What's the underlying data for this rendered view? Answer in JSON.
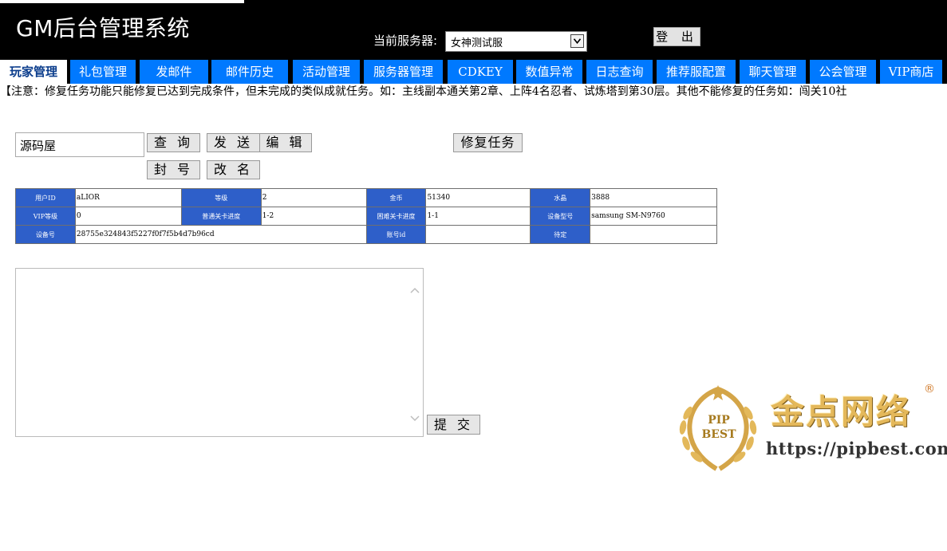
{
  "header": {
    "title": "GM后台管理系统",
    "server_label": "当前服务器:",
    "server_value": "女神测试服",
    "logout_label": "登 出"
  },
  "nav": {
    "tabs": [
      {
        "label": "玩家管理",
        "active": true
      },
      {
        "label": "礼包管理"
      },
      {
        "label": "发邮件"
      },
      {
        "label": "邮件历史"
      },
      {
        "label": "活动管理"
      },
      {
        "label": "服务器管理"
      },
      {
        "label": "CDKEY"
      },
      {
        "label": "数值异常"
      },
      {
        "label": "日志查询"
      },
      {
        "label": "推荐服配置"
      },
      {
        "label": "聊天管理"
      },
      {
        "label": "公会管理"
      },
      {
        "label": "VIP商店"
      }
    ]
  },
  "notice": "【注意：修复任务功能只能修复已达到完成条件，但未完成的类似成就任务。如：主线副本通关第2章、上阵4名忍者、试炼塔到第30层。其他不能修复的任务如：闯关10社",
  "search": {
    "input_value": "源码屋",
    "query_label": "查 询",
    "send_label": "发 送",
    "edit_label": "编 辑",
    "repair_label": "修复任务",
    "ban_label": "封 号",
    "rename_label": "改 名"
  },
  "player_info": {
    "row1": [
      {
        "label": "用户ID",
        "value": "aLIOR"
      },
      {
        "label": "等级",
        "value": "2"
      },
      {
        "label": "金币",
        "value": "51340"
      },
      {
        "label": "水晶",
        "value": "3888"
      }
    ],
    "row2": [
      {
        "label": "VIP等级",
        "value": "0"
      },
      {
        "label": "普通关卡进度",
        "value": "1-2"
      },
      {
        "label": "困难关卡进度",
        "value": "1-1"
      },
      {
        "label": "设备型号",
        "value": "samsung SM-N9760"
      }
    ],
    "row3": [
      {
        "label": "设备号",
        "value": "28755e324843f5227f0f7f5b4d7b96cd"
      },
      {
        "label": "账号id",
        "value": ""
      },
      {
        "label": "待定",
        "value": ""
      }
    ]
  },
  "submit_label": "提 交",
  "watermark": {
    "badge_text": "PIP BEST",
    "name": "金点网络",
    "url": "https://pipbest.com",
    "reg": "®"
  }
}
